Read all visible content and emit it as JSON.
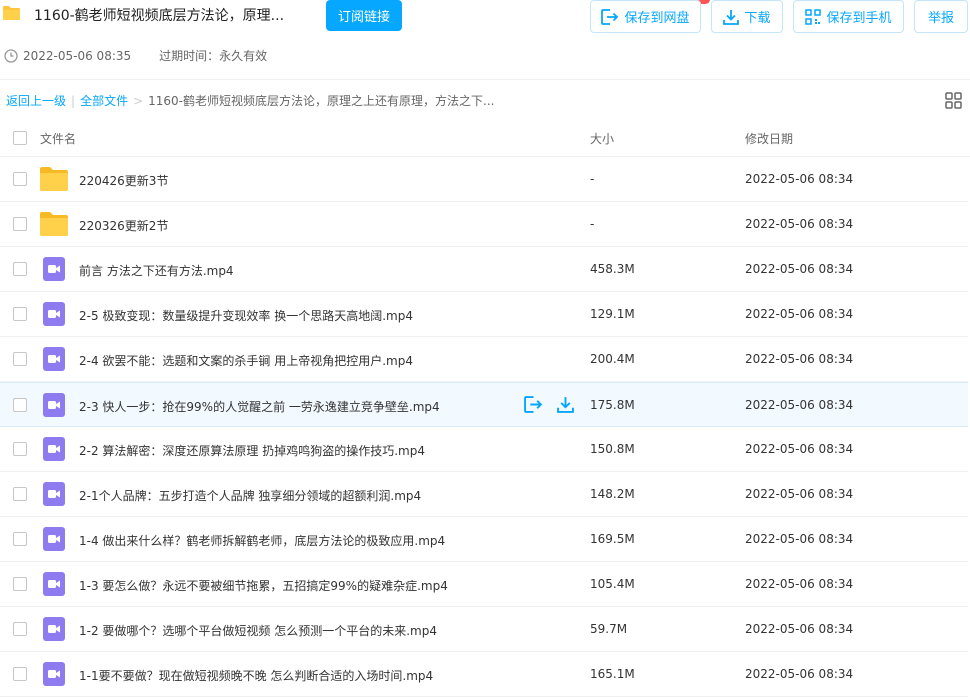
{
  "header": {
    "title": "1160-鹤老师短视频底层方法论，原理...",
    "subscribe_label": "订阅链接",
    "save_to_disk_label": "保存到网盘",
    "download_label": "下载",
    "save_to_phone_label": "保存到手机",
    "report_label": "举报",
    "share_time": "2022-05-06 08:35",
    "expire_label": "过期时间：永久有效"
  },
  "breadcrumb": {
    "back": "返回上一级",
    "root": "全部文件",
    "separator_1": "|",
    "separator_2": ">",
    "current": "1160-鹤老师短视频底层方法论，原理之上还有原理，方法之下..."
  },
  "table": {
    "col_name": "文件名",
    "col_size": "大小",
    "col_date": "修改日期",
    "rows": [
      {
        "type": "folder",
        "name": "220426更新3节",
        "size": "-",
        "date": "2022-05-06 08:34"
      },
      {
        "type": "folder",
        "name": "220326更新2节",
        "size": "-",
        "date": "2022-05-06 08:34"
      },
      {
        "type": "video",
        "name": "前言 方法之下还有方法.mp4",
        "size": "458.3M",
        "date": "2022-05-06 08:34"
      },
      {
        "type": "video",
        "name": "2-5 极致变现：数量级提升变现效率 换一个思路天高地阔.mp4",
        "size": "129.1M",
        "date": "2022-05-06 08:34"
      },
      {
        "type": "video",
        "name": "2-4 欲罢不能：选题和文案的杀手锏 用上帝视角把控用户.mp4",
        "size": "200.4M",
        "date": "2022-05-06 08:34"
      },
      {
        "type": "video",
        "name": "2-3 快人一步：抢在99%的人觉醒之前 一劳永逸建立竞争壁垒.mp4",
        "size": "175.8M",
        "date": "2022-05-06 08:34"
      },
      {
        "type": "video",
        "name": "2-2 算法解密：深度还原算法原理 扔掉鸡鸣狗盗的操作技巧.mp4",
        "size": "150.8M",
        "date": "2022-05-06 08:34"
      },
      {
        "type": "video",
        "name": "2-1个人品牌：五步打造个人品牌 独享细分领域的超额利润.mp4",
        "size": "148.2M",
        "date": "2022-05-06 08:34"
      },
      {
        "type": "video",
        "name": "1-4 做出来什么样？鹤老师拆解鹤老师，底层方法论的极致应用.mp4",
        "size": "169.5M",
        "date": "2022-05-06 08:34"
      },
      {
        "type": "video",
        "name": "1-3 要怎么做？永远不要被细节拖累，五招搞定99%的疑难杂症.mp4",
        "size": "105.4M",
        "date": "2022-05-06 08:34"
      },
      {
        "type": "video",
        "name": "1-2 要做哪个？选哪个平台做短视频 怎么预测一个平台的未来.mp4",
        "size": "59.7M",
        "date": "2022-05-06 08:34"
      },
      {
        "type": "video",
        "name": "1-1要不要做？现在做短视频晚不晚 怎么判断合适的入场时间.mp4",
        "size": "165.1M",
        "date": "2022-05-06 08:34"
      }
    ],
    "hover_row_index": 5
  },
  "colors": {
    "accent": "#06a7ff",
    "folder": "#ffd04a",
    "video": "#8e7bf0",
    "hover_row": "#f2f9ff"
  },
  "icons": {
    "folder": "folder-icon",
    "video": "video-file-icon",
    "clock": "clock-icon",
    "save": "save-to-disk-icon",
    "download": "download-icon",
    "phone": "qr-phone-icon",
    "grid": "grid-view-icon"
  }
}
